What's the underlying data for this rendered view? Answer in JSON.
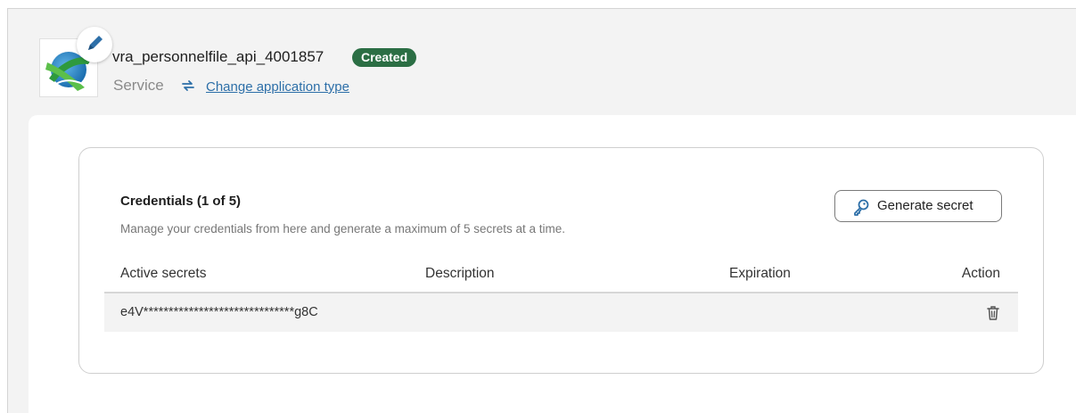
{
  "app": {
    "name": "vra_personnelfile_api_4001857",
    "status": "Created",
    "type": "Service",
    "change_type_link": "Change application type",
    "icon": "globe-logo",
    "edit_icon": "pencil-icon",
    "type_icon": "sync-icon"
  },
  "credentials": {
    "title": "Credentials (1 of 5)",
    "subtitle": "Manage your credentials from here and generate a maximum of 5 secrets at a time.",
    "generate_button": "Generate secret",
    "generate_icon": "key-icon",
    "columns": [
      "Active secrets",
      "Description",
      "Expiration",
      "Action"
    ],
    "rows": [
      {
        "secret": "e4V******************************g8C",
        "description": "",
        "expiration": "",
        "action_icon": "trash-icon"
      }
    ]
  },
  "colors": {
    "status_badge": "#2b6e44",
    "link": "#2d6fa8",
    "frame_bg": "#f3f3f3"
  }
}
